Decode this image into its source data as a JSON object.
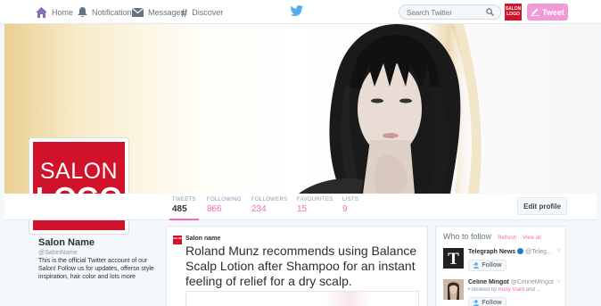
{
  "nav": {
    "home": "Home",
    "notifications": "Notifications",
    "messages": "Messages",
    "discover": "Discover",
    "search_placeholder": "Search Twitter",
    "mini_logo": "SALON LOGO",
    "tweet_label": "Tweet"
  },
  "profile": {
    "logo_line1": "SALON",
    "logo_line2": "LOGO",
    "name": "Salon Name",
    "handle": "@SalonName",
    "description": "This is the official Twitter account of our Salon! Follow us for updates, offersn style inspiration, hair color and lots more"
  },
  "stats": [
    {
      "label": "TWEETS",
      "value": "485"
    },
    {
      "label": "FOLLOWING",
      "value": "866"
    },
    {
      "label": "FOLLOWERS",
      "value": "234"
    },
    {
      "label": "FAVOURITES",
      "value": "15"
    },
    {
      "label": "LISTS",
      "value": "9"
    }
  ],
  "edit_profile": "Edit profile",
  "tweet": {
    "avatar_text": "SALON",
    "author": "Salon name",
    "text": "Roland Munz recommends using Balance Scalp Lotion after Shampoo for an instant feeling of relief for a dry scalp."
  },
  "who_to_follow": {
    "title": "Who to follow",
    "refresh": "Refresh",
    "separator": "·",
    "view_all": "View all",
    "follow_label": "Follow",
    "close": "×",
    "suggestions": [
      {
        "name": "Telegraph News",
        "handle": "@Teleg...",
        "sub_prefix": "",
        "sub_link": "",
        "sub_suffix": ""
      },
      {
        "name": "Celine Mingot",
        "handle": "@CelineMingot",
        "sub_prefix": "Followed by ",
        "sub_link": "Rudy Viard",
        "sub_suffix": " and ..."
      }
    ]
  },
  "colors": {
    "accent": "#f06eb6",
    "tweet_button": "#f19ad8",
    "brand_red": "#d0122a",
    "twitter_blue": "#55acee"
  }
}
